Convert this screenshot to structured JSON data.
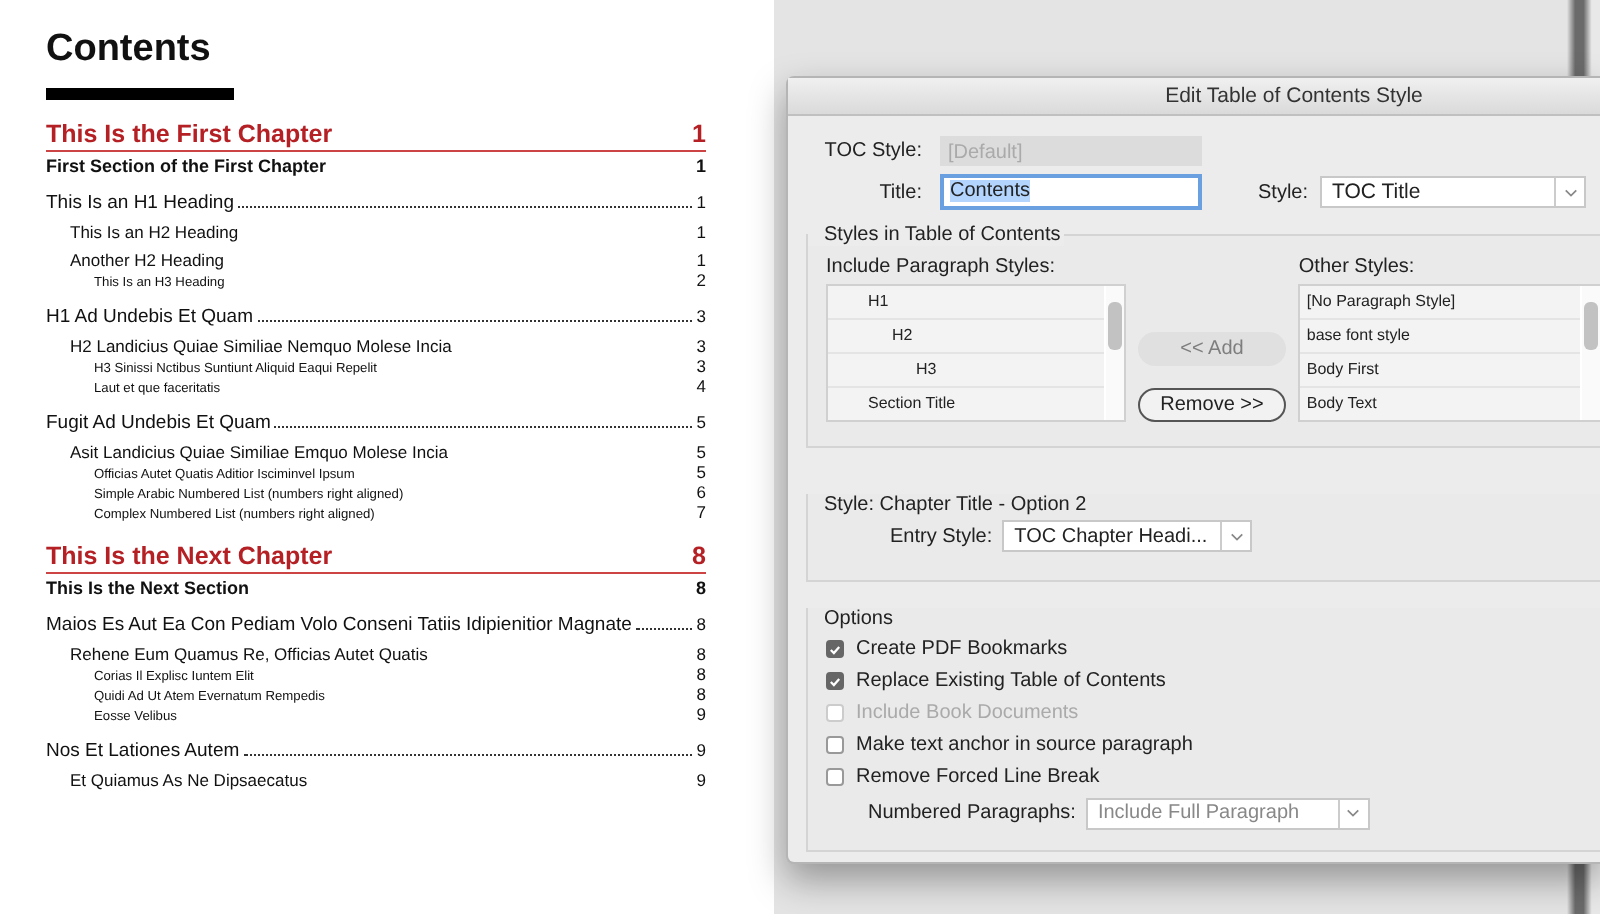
{
  "document": {
    "title": "Contents",
    "entries": [
      {
        "kind": "chapter",
        "text": "This Is the First Chapter",
        "page": "1"
      },
      {
        "kind": "section",
        "text": "First Section of the First Chapter",
        "page": "1"
      },
      {
        "kind": "h1",
        "text": "This Is an H1 Heading",
        "page": "1"
      },
      {
        "kind": "h2",
        "text": "This Is an H2 Heading",
        "page": "1"
      },
      {
        "kind": "h2",
        "text": "Another H2 Heading",
        "page": "1"
      },
      {
        "kind": "h3",
        "text": "This Is an H3 Heading",
        "page": "2"
      },
      {
        "kind": "h1",
        "text": "H1 Ad Undebis Et Quam",
        "page": "3"
      },
      {
        "kind": "h2",
        "text": "H2 Landicius Quiae Similiae Nemquo Molese Incia",
        "page": "3"
      },
      {
        "kind": "h3",
        "text": "H3 Sinissi Nctibus Suntiunt Aliquid Eaqui Repelit",
        "page": "3"
      },
      {
        "kind": "h3",
        "text": "Laut et que faceritatis",
        "page": "4"
      },
      {
        "kind": "h1",
        "text": "Fugit Ad Undebis Et Quam",
        "page": "5"
      },
      {
        "kind": "h2",
        "text": "Asit Landicius Quiae Similiae Emquo Molese Incia",
        "page": "5"
      },
      {
        "kind": "h3",
        "text": "Officias Autet Quatis Aditior Isciminvel Ipsum",
        "page": "5"
      },
      {
        "kind": "h3",
        "text": "Simple Arabic Numbered List (numbers right aligned)",
        "page": "6"
      },
      {
        "kind": "h3",
        "text": "Complex Numbered List (numbers right aligned)",
        "page": "7"
      },
      {
        "kind": "chapter",
        "text": "This Is the Next Chapter",
        "page": "8"
      },
      {
        "kind": "section",
        "text": "This Is the Next Section",
        "page": "8"
      },
      {
        "kind": "h1",
        "text": "Maios Es Aut Ea Con Pediam Volo Conseni Tatiis Idipienitior Magnate",
        "page": "8"
      },
      {
        "kind": "h2",
        "text": "Rehene Eum Quamus Re, Officias Autet Quatis",
        "page": "8"
      },
      {
        "kind": "h3",
        "text": "Corias Il Explisc Iuntem Elit",
        "page": "8"
      },
      {
        "kind": "h3",
        "text": "Quidi Ad Ut Atem Evernatum Rempedis",
        "page": "8"
      },
      {
        "kind": "h3",
        "text": "Eosse Velibus",
        "page": "9"
      },
      {
        "kind": "h1",
        "text": "Nos Et Lationes Autem",
        "page": "9"
      },
      {
        "kind": "h2",
        "text": "Et Quiamus As Ne Dipsaecatus",
        "page": "9"
      }
    ]
  },
  "dialog": {
    "title": "Edit Table of Contents Style",
    "toc_style": {
      "label": "TOC Style:",
      "value": "[Default]",
      "disabled": true
    },
    "title_field": {
      "label": "Title:",
      "value": "Contents"
    },
    "style_select": {
      "label": "Style:",
      "value": "TOC Title"
    },
    "styles_group": {
      "legend": "Styles in Table of Contents",
      "include_label": "Include Paragraph Styles:",
      "include_items": [
        {
          "label": "H1",
          "children": [
            {
              "label": "H2",
              "children": [
                {
                  "label": "H3"
                }
              ]
            }
          ]
        },
        {
          "label": "Section Title"
        }
      ],
      "add_button": {
        "label": "<< Add",
        "disabled": true
      },
      "remove_button": {
        "label": "Remove >>",
        "disabled": false
      },
      "other_label": "Other Styles:",
      "other_items": [
        "[No Paragraph Style]",
        "base font style",
        "Body First",
        "Body Text"
      ]
    },
    "style_group": {
      "legend": "Style: Chapter Title - Option 2",
      "entry_label": "Entry Style:",
      "entry_value": "TOC Chapter Headi..."
    },
    "options": {
      "legend": "Options",
      "checkboxes": [
        {
          "label": "Create PDF Bookmarks",
          "checked": true,
          "disabled": false
        },
        {
          "label": "Replace Existing Table of Contents",
          "checked": true,
          "disabled": false
        },
        {
          "label": "Include Book Documents",
          "checked": false,
          "disabled": true
        },
        {
          "label": "Make text anchor in source paragraph",
          "checked": false,
          "disabled": false
        },
        {
          "label": "Remove Forced Line Break",
          "checked": false,
          "disabled": false
        }
      ],
      "numbered_label": "Numbered Paragraphs:",
      "numbered_value": "Include Full Paragraph"
    }
  }
}
